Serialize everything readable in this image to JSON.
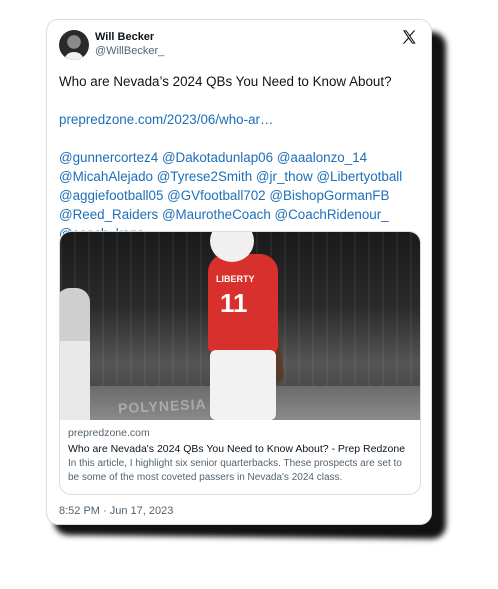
{
  "author": {
    "name": "Will Becker",
    "handle": "@WillBecker_"
  },
  "tweet": {
    "text": "Who are Nevada’s 2024 QBs You Need to Know About?",
    "link": "prepredzone.com/2023/06/who-ar…",
    "mentions": [
      "@gunnercortez4",
      "@Dakotadunlap06",
      "@aaalonzo_14",
      "@MicahAlejado",
      "@Tyrese2Smith",
      "@jr_thow",
      "@Libertyotball",
      "@aggiefootball05",
      "@GVfootball702",
      "@BishopGormanFB",
      "@Reed_Raiders",
      "@MaurotheCoach",
      "@CoachRidenour_",
      "@coach_kaps"
    ],
    "timestamp": "8:52 PM · Jun 17, 2023"
  },
  "card": {
    "domain": "prepredzone.com",
    "title": "Who are Nevada's 2024 QBs You Need to Know About? - Prep Redzone",
    "description": "In this article, I highlight six senior quarterbacks. These prospects are set to be some of the most coveted passers in Nevada's 2024 class.",
    "photo_banner": "POLYNESIA",
    "jersey_text": "LIBERTY",
    "jersey_number": "11"
  },
  "icons": {
    "logo": "x-logo-icon",
    "avatar": "avatar"
  }
}
